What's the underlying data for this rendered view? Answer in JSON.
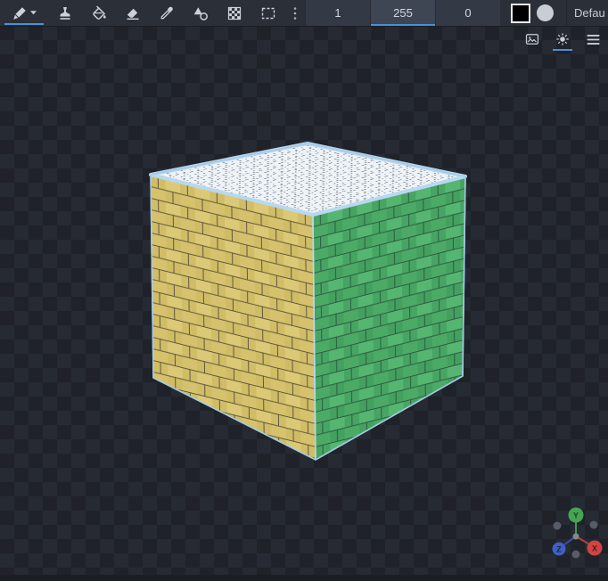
{
  "toolbar": {
    "tools": [
      {
        "name": "pen",
        "icon": "pen-icon",
        "active": true
      },
      {
        "name": "stamp",
        "icon": "stamp-icon",
        "active": false
      },
      {
        "name": "fill",
        "icon": "fill-bucket-icon",
        "active": false
      },
      {
        "name": "eraser",
        "icon": "eraser-icon",
        "active": false
      },
      {
        "name": "color-picker",
        "icon": "eyedropper-icon",
        "active": false
      },
      {
        "name": "shapes",
        "icon": "shapes-icon",
        "active": false
      },
      {
        "name": "dither",
        "icon": "checker-pattern-icon",
        "active": false
      },
      {
        "name": "selection",
        "icon": "selection-rect-icon",
        "active": false
      },
      {
        "name": "more-options",
        "icon": "vertical-dots-icon",
        "active": false
      }
    ],
    "number_inputs": [
      {
        "value": "1",
        "focused": false
      },
      {
        "value": "255",
        "focused": true
      },
      {
        "value": "0",
        "focused": false
      }
    ],
    "brush_shapes": [
      {
        "name": "square",
        "selected": true
      },
      {
        "name": "circle",
        "selected": false
      }
    ],
    "palette_label": "Defau"
  },
  "view_bar": {
    "buttons": [
      {
        "name": "image",
        "icon": "image-icon",
        "active": false
      },
      {
        "name": "lighting",
        "icon": "sun-icon",
        "active": true
      },
      {
        "name": "menu",
        "icon": "hamburger-menu-icon",
        "active": false
      }
    ]
  },
  "scene": {
    "object": "voxel-cube",
    "top_face_color": "#eef3f8",
    "left_face_color": "#d8c672",
    "right_face_color": "#4fae6b",
    "edge_highlight_color": "#b7d8f0"
  },
  "gizmo": {
    "labels": {
      "x": "X",
      "y": "Y",
      "z": "Z"
    },
    "colors": {
      "x": "#cf4444",
      "y": "#46a552",
      "z": "#3f5fc0",
      "negative": "#565d66"
    }
  },
  "colors": {
    "accent": "#4a90d9",
    "toolbar_bg": "#2b2f38",
    "checker_dark": "#1f2229",
    "checker_light": "#262a32"
  }
}
